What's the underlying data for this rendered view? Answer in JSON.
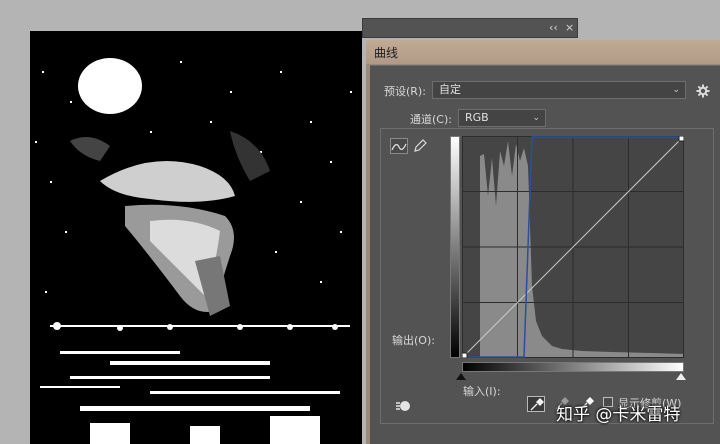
{
  "panel_strip": {
    "collapse_glyph": "‹‹",
    "close_glyph": "×"
  },
  "dialog": {
    "title": "曲线",
    "preset_label": "预设(R):",
    "preset_value": "自定",
    "channel_label": "通道(C):",
    "channel_value": "RGB",
    "output_label": "输出(O):",
    "input_label": "输入(I):",
    "show_clipping_label": "显示修剪(W)",
    "show_clipping_checked": false,
    "curve_mode": "curve-icon",
    "pencil_mode": "pencil-icon"
  },
  "watermark": {
    "text": "知乎 @卡米雷特"
  }
}
